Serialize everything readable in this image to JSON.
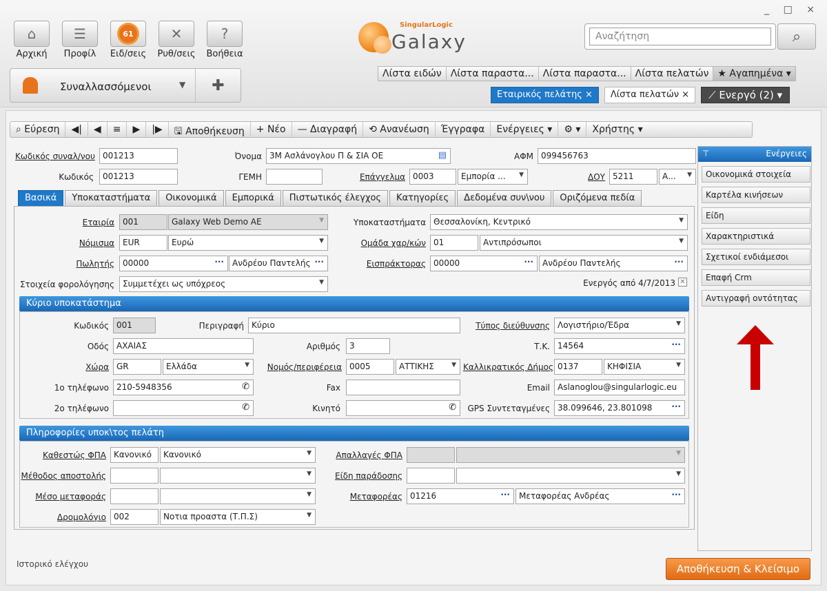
{
  "window": {
    "controls": "_ □ ×"
  },
  "nav": [
    {
      "label": "Αρχική",
      "icon": "home-icon",
      "glyph": "⌂"
    },
    {
      "label": "Προφίλ",
      "icon": "profile-icon",
      "glyph": "☰"
    },
    {
      "label": "Ειδ/σεις",
      "icon": "notifications-icon",
      "badge": "61"
    },
    {
      "label": "Ρυθ/σεις",
      "icon": "settings-tools-icon",
      "glyph": "✕"
    },
    {
      "label": "Βοήθεια",
      "icon": "help-icon",
      "glyph": "?"
    }
  ],
  "partner_selector": {
    "label": "Συναλλασσόμενοι"
  },
  "logo": {
    "brand": "SingularLogic",
    "product": "Galaxy"
  },
  "search": {
    "placeholder": "Αναζήτηση"
  },
  "quick_tabs": [
    "Λίστα ειδών",
    "Λίστα παραστα...",
    "Λίστα παραστα...",
    "Λίστα πελατών",
    "★ Αγαπημένα ▾"
  ],
  "open_tabs": [
    {
      "label": "Εταιρικός πελάτης ×",
      "active": true
    },
    {
      "label": "Λίστα πελατών ×",
      "active": false
    },
    {
      "label": "⟋ Ενεργό (2) ▾",
      "active": false
    }
  ],
  "toolbar": [
    "⌕ Εύρεση",
    "◀|",
    "◀",
    "≡",
    "▶",
    "|▶",
    "🖫 Αποθήκευση",
    "+ Νέο",
    "— Διαγραφή",
    "⟲ Ανανέωση",
    "Έγγραφα",
    "Ενέργειες ▾",
    "⚙ ▾",
    "Χρήστης ▾"
  ],
  "header": {
    "code_partner_label": "Κωδικός συναλ/νου",
    "code_partner": "001213",
    "name_label": "Όνομα",
    "name": "3Μ Ασλάνογλου Π & ΣΙΑ ΟΕ",
    "afm_label": "ΑΦΜ",
    "afm": "099456763",
    "code_label": "Κωδικός",
    "code": "001213",
    "gemh_label": "ΓΕΜΗ",
    "gemh": "",
    "profession_label": "Επάγγελμα",
    "profession_code": "0003",
    "profession": "Εμπορία ...",
    "doy_label": "ΔΟΥ",
    "doy_code": "5211",
    "doy": "Α..."
  },
  "form_tabs": [
    "Βασικά",
    "Υποκαταστήματα",
    "Οικονομικά",
    "Εμπορικά",
    "Πιστωτικός έλεγχος",
    "Κατηγορίες",
    "Δεδομένα συν\\νου",
    "Οριζόμενα πεδία"
  ],
  "basic": {
    "company_label": "Εταιρία",
    "company_code": "001",
    "company": "Galaxy Web Demo AE",
    "branches_label": "Υποκαταστήματα",
    "branches": "Θεσσαλονίκη, Κεντρικό",
    "currency_label": "Νόμισμα",
    "currency_code": "EUR",
    "currency": "Ευρώ",
    "group_label": "Ομάδα χαρ/κών",
    "group_code": "01",
    "group": "Αντιπρόσωποι",
    "seller_label": "Πωλητής",
    "seller_code": "00000",
    "seller": "Ανδρέου Παντελής",
    "collector_label": "Εισπράκτορας",
    "collector_code": "00000",
    "collector": "Ανδρέου Παντελής",
    "tax_label": "Στοιχεία φορολόγησης",
    "tax": "Συμμετέχει ως υπόχρεος",
    "active_label": "Ενεργός από 4/7/2013"
  },
  "main_branch": {
    "title": "Κύριο υποκατάστημα",
    "code_label": "Κωδικός",
    "code": "001",
    "desc_label": "Περιγραφή",
    "desc": "Κύριο",
    "addr_type_label": "Τύπος διεύθυνσης",
    "addr_type": "Λογιστήριο/Έδρα",
    "street_label": "Οδός",
    "street": "ΑΧΑΙΑΣ",
    "number_label": "Αριθμός",
    "number": "3",
    "zip_label": "Τ.Κ.",
    "zip": "14564",
    "country_label": "Χώρα",
    "country_code": "GR",
    "country": "Ελλάδα",
    "region_label": "Νομός/περιφέρεια",
    "region_code": "0005",
    "region": "ΑΤΤΙΚΗΣ",
    "municipality_label": "Καλλικρατικός Δήμος",
    "municipality_code": "0137",
    "municipality": "ΚΗΦΙΣΙΑ",
    "phone1_label": "1ο τηλέφωνο",
    "phone1": "210-5948356",
    "fax_label": "Fax",
    "fax": "",
    "email_label": "Email",
    "email": "Aslanoglou@singularlogic.eu",
    "phone2_label": "2ο τηλέφωνο",
    "phone2": "",
    "mobile_label": "Κινητό",
    "mobile": "",
    "gps_label": "GPS Συντεταγμένες",
    "gps": "38.099646, 23.801098"
  },
  "customer_info": {
    "title": "Πληροφορίες υποκ\\τος πελάτη",
    "vat_label": "Καθεστώς ΦΠΑ",
    "vat_code": "Κανονικό",
    "vat": "Κανονικό",
    "vat_ex_label": "Απαλλαγές ΦΠΑ",
    "ship_method_label": "Μέθοδος αποστολής",
    "delivery_label": "Είδη παράδοσης",
    "transport_label": "Μέσο μεταφοράς",
    "carrier_label": "Μεταφορέας",
    "carrier_code": "01216",
    "carrier": "Μεταφορέας Ανδρέας",
    "route_label": "Δρομολόγιο",
    "route_code": "002",
    "route": "Νοτια προαστα (Τ.Π.Σ)"
  },
  "side": {
    "title": "Ενέργειες",
    "items": [
      "Οικονομικά στοιχεία",
      "Καρτέλα κινήσεων",
      "Είδη",
      "Χαρακτηριστικά",
      "Σχετικοί ενδιάμεσοι",
      "Επαφή Crm",
      "Αντιγραφή οντότητας"
    ]
  },
  "footer": {
    "history": "Ιστορικό ελέγχου",
    "save_close": "Αποθήκευση & Κλείσιμο"
  },
  "colors": {
    "accent": "#1f78c8",
    "orange": "#e8731a",
    "arrow": "#c80000"
  }
}
